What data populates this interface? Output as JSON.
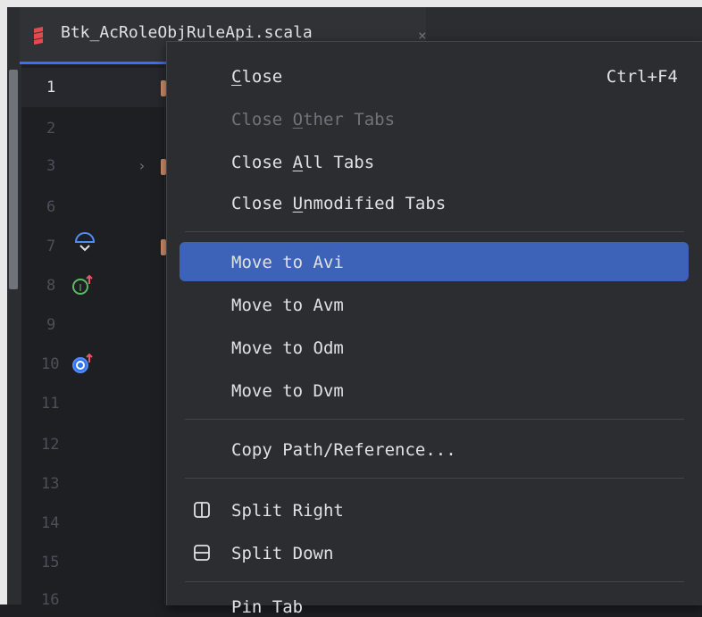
{
  "tab": {
    "title": "Btk_AcRoleObjRuleApi.scala",
    "close_glyph": "×",
    "icon": "scala-file-icon",
    "accent": "#3574f0",
    "icon_color": "#e5484d"
  },
  "editor": {
    "line_numbers": [
      "1",
      "2",
      "3",
      "6",
      "7",
      "8",
      "9",
      "10",
      "11",
      "12",
      "13",
      "14",
      "15",
      "16"
    ],
    "current_line": "1"
  },
  "context_menu": {
    "close": {
      "label": "Close",
      "mnemonic": "C",
      "shortcut": "Ctrl+F4"
    },
    "close_other": {
      "label": "Close Other Tabs",
      "pre": "Close ",
      "mnemonic": "O",
      "post": "ther Tabs"
    },
    "close_all": {
      "pre": "Close ",
      "mnemonic": "A",
      "post": "ll Tabs"
    },
    "close_unmodified": {
      "pre": "Close ",
      "mnemonic": "U",
      "post": "nmodified Tabs"
    },
    "move_avi": "Move to Avi",
    "move_avm": "Move to Avm",
    "move_odm": "Move to Odm",
    "move_dvm": "Move to Dvm",
    "copy_path": "Copy Path/Reference...",
    "split_right": "Split Right",
    "split_down": "Split Down",
    "pin_tab_partial": "Pin Tab",
    "highlight_color": "#3d63b8"
  }
}
